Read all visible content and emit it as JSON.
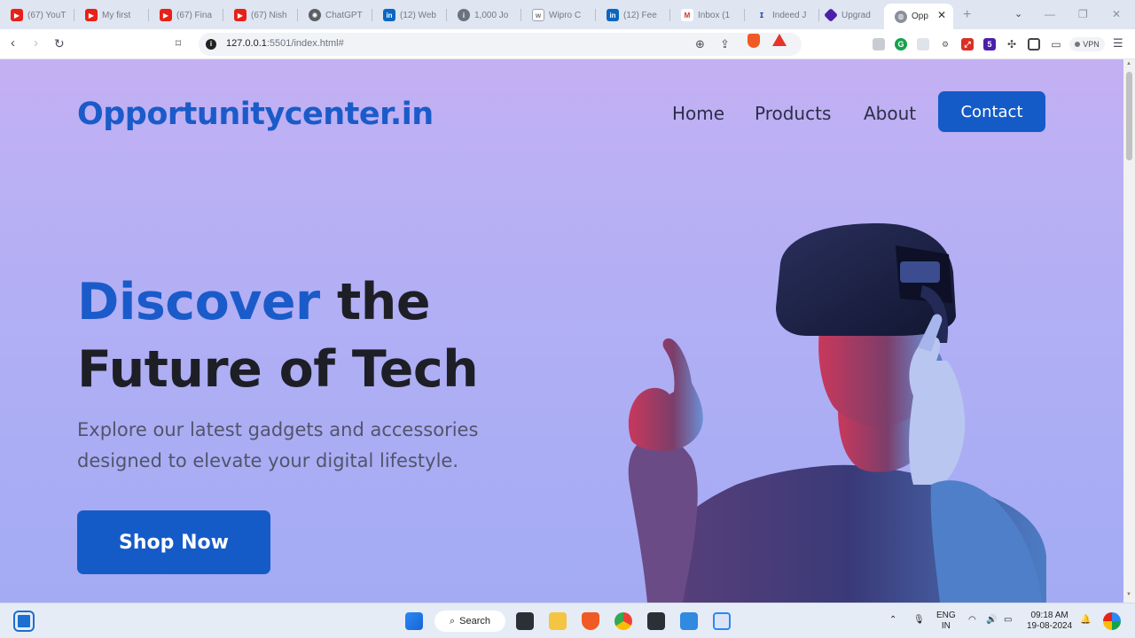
{
  "browser": {
    "tabs": [
      {
        "title": "(67) YouT",
        "icon": "youtube-icon"
      },
      {
        "title": "My first",
        "icon": "youtube-icon"
      },
      {
        "title": "(67) Fina",
        "icon": "youtube-icon"
      },
      {
        "title": "(67) Nish",
        "icon": "youtube-icon"
      },
      {
        "title": "ChatGPT",
        "icon": "chatgpt-icon"
      },
      {
        "title": "(12) Web",
        "icon": "linkedin-icon"
      },
      {
        "title": "1,000 Jo",
        "icon": "info-icon"
      },
      {
        "title": "Wipro C",
        "icon": "wipro-icon"
      },
      {
        "title": "(12) Fee",
        "icon": "linkedin-icon"
      },
      {
        "title": "Inbox (1",
        "icon": "gmail-icon"
      },
      {
        "title": "Indeed J",
        "icon": "indeed-icon"
      },
      {
        "title": "Upgrad",
        "icon": "upgrad-icon"
      },
      {
        "title": "Opp",
        "icon": "globe-icon"
      }
    ],
    "url_host": "127.0.0.1",
    "url_rest": ":5501/index.html#",
    "vpn_label": "VPN",
    "ext_badge": "5"
  },
  "site": {
    "logo": "Opportunitycenter.in",
    "nav": {
      "home": "Home",
      "products": "Products",
      "about": "About",
      "contact": "Contact"
    },
    "hero": {
      "title_accent": "Discover",
      "title_rest1": " the",
      "title_line2": "Future of Tech",
      "subtitle": "Explore our latest gadgets and accessories designed to elevate your digital lifestyle.",
      "cta": "Shop Now"
    }
  },
  "taskbar": {
    "search_label": "Search",
    "lang1": "ENG",
    "lang2": "IN",
    "time": "09:18 AM",
    "date": "19-08-2024"
  },
  "colors": {
    "brand": "#1a5bc9",
    "button": "#155bc7",
    "hero_bg_top": "#c3b0f3",
    "hero_bg_bottom": "#a3abf3"
  }
}
